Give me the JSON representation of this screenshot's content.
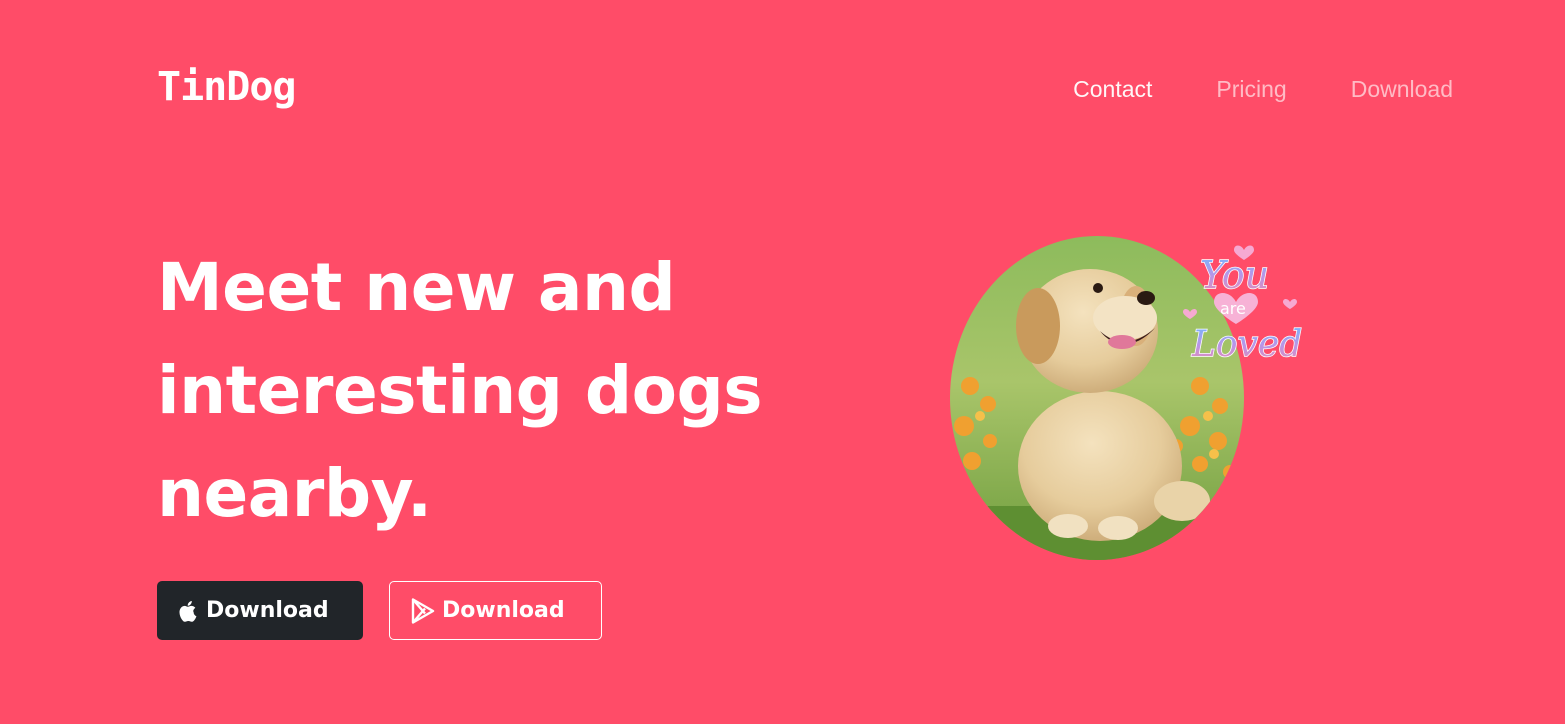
{
  "brand": {
    "name": "TinDog"
  },
  "nav": {
    "items": [
      {
        "label": "Contact"
      },
      {
        "label": "Pricing"
      },
      {
        "label": "Download"
      }
    ]
  },
  "hero": {
    "headline_lines": [
      "Meet new and",
      "interesting dogs",
      "nearby."
    ],
    "buttons": [
      {
        "label": "Download",
        "icon": "apple-icon",
        "style": "dark"
      },
      {
        "label": "Download",
        "icon": "google-play-icon",
        "style": "outline"
      }
    ],
    "image": {
      "subject": "golden retriever puppy sitting in flower field",
      "sticker_text": [
        "You",
        "are",
        "Loved"
      ]
    }
  },
  "colors": {
    "background": "#ff4c68",
    "dark_button": "#212529",
    "text": "#ffffff"
  }
}
